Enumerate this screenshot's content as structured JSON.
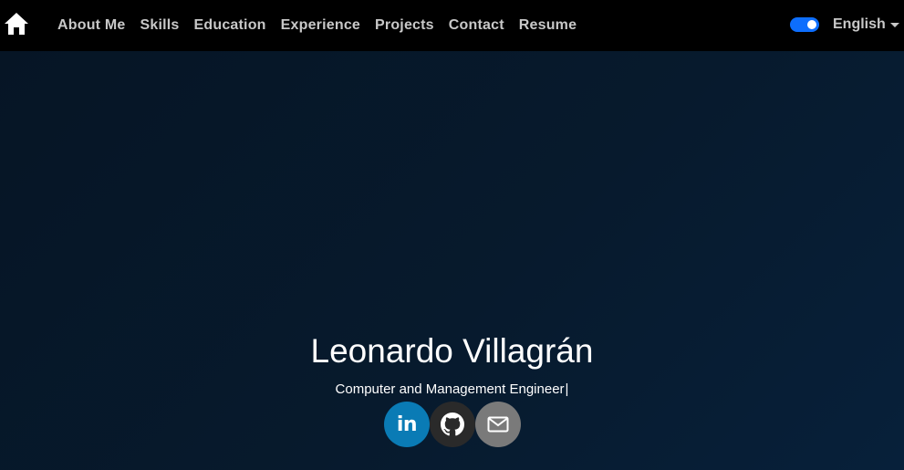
{
  "navbar": {
    "home_icon": "home-icon",
    "links": [
      {
        "label": "About Me"
      },
      {
        "label": "Skills"
      },
      {
        "label": "Education"
      },
      {
        "label": "Experience"
      },
      {
        "label": "Projects"
      },
      {
        "label": "Contact"
      },
      {
        "label": "Resume"
      }
    ],
    "theme_toggle": {
      "state": "on",
      "accent_color": "#0d6efd"
    },
    "language": {
      "selected": "English"
    }
  },
  "hero": {
    "name": "Leonardo Villagrán",
    "subtitle": "Computer and Management Engineer",
    "cursor": "|",
    "socials": [
      {
        "name": "linkedin",
        "icon": "linkedin-icon",
        "glyph": "in",
        "color": "#0a7bb5"
      },
      {
        "name": "github",
        "icon": "github-icon",
        "color": "#2a2a2a"
      },
      {
        "name": "email",
        "icon": "mail-icon",
        "color": "#7a7a7a"
      }
    ]
  }
}
